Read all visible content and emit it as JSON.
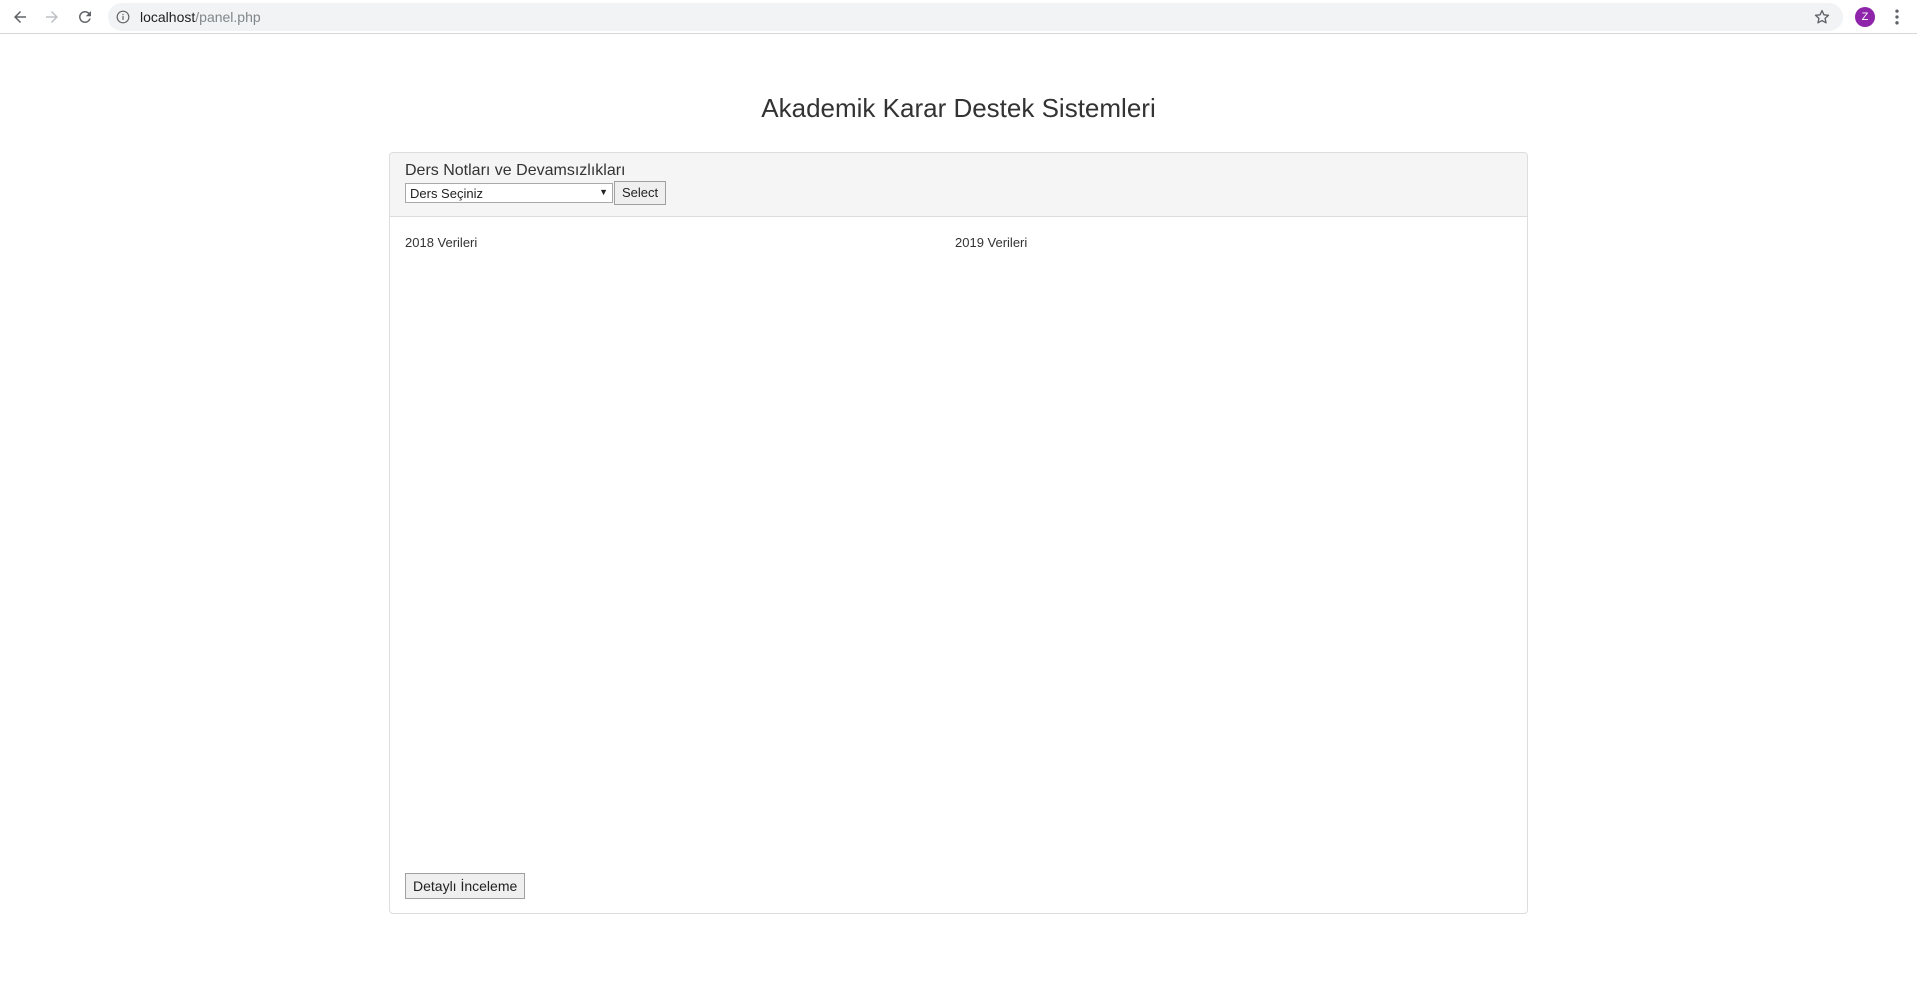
{
  "browser": {
    "url_host": "localhost",
    "url_path": "/panel.php",
    "avatar_letter": "Z",
    "avatar_color": "#8e24aa"
  },
  "page": {
    "title": "Akademik Karar Destek Sistemleri"
  },
  "panel": {
    "heading": "Ders Notları ve Devamsızlıkları",
    "select_value": "Ders Seçiniz",
    "select_button": "Select",
    "left_label": "2018 Verileri",
    "right_label": "2019 Verileri",
    "detail_button": "Detaylı İnceleme"
  },
  "icons": {
    "back": "back-arrow-icon",
    "forward": "forward-arrow-icon",
    "reload": "reload-icon",
    "info": "info-icon",
    "star": "star-icon",
    "menu": "kebab-menu-icon"
  }
}
